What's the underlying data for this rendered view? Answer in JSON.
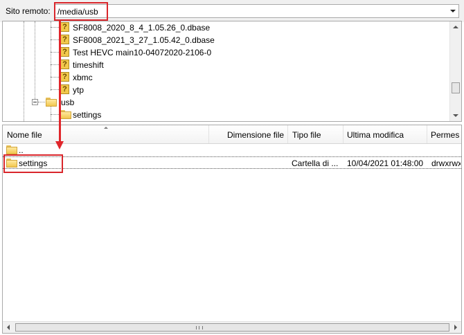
{
  "top_bar": {
    "label": "Sito remoto:",
    "path": "/media/usb"
  },
  "tree": {
    "items": [
      {
        "label": "SF8008_2020_8_4_1.05.26_0.dbase",
        "icon": "question-folder-icon"
      },
      {
        "label": "SF8008_2021_3_27_1.05.42_0.dbase",
        "icon": "question-folder-icon"
      },
      {
        "label": "Test HEVC main10-04072020-2106-0",
        "icon": "question-folder-icon"
      },
      {
        "label": "timeshift",
        "icon": "question-folder-icon"
      },
      {
        "label": "xbmc",
        "icon": "question-folder-icon"
      },
      {
        "label": "ytp",
        "icon": "question-folder-icon"
      },
      {
        "label": "usb",
        "icon": "folder-icon"
      },
      {
        "label": "settings",
        "icon": "folder-icon"
      }
    ]
  },
  "file_list": {
    "columns": [
      "Nome file",
      "Dimensione file",
      "Tipo file",
      "Ultima modifica",
      "Permes"
    ],
    "rows": [
      {
        "name": "..",
        "size": "",
        "type": "",
        "modified": "",
        "perms": ""
      },
      {
        "name": "settings",
        "size": "",
        "type": "Cartella di ...",
        "modified": "10/04/2021 01:48:00",
        "perms": "drwxrwx"
      }
    ]
  },
  "colors": {
    "annotation": "#e0262b",
    "folder": "#f1c64f"
  }
}
